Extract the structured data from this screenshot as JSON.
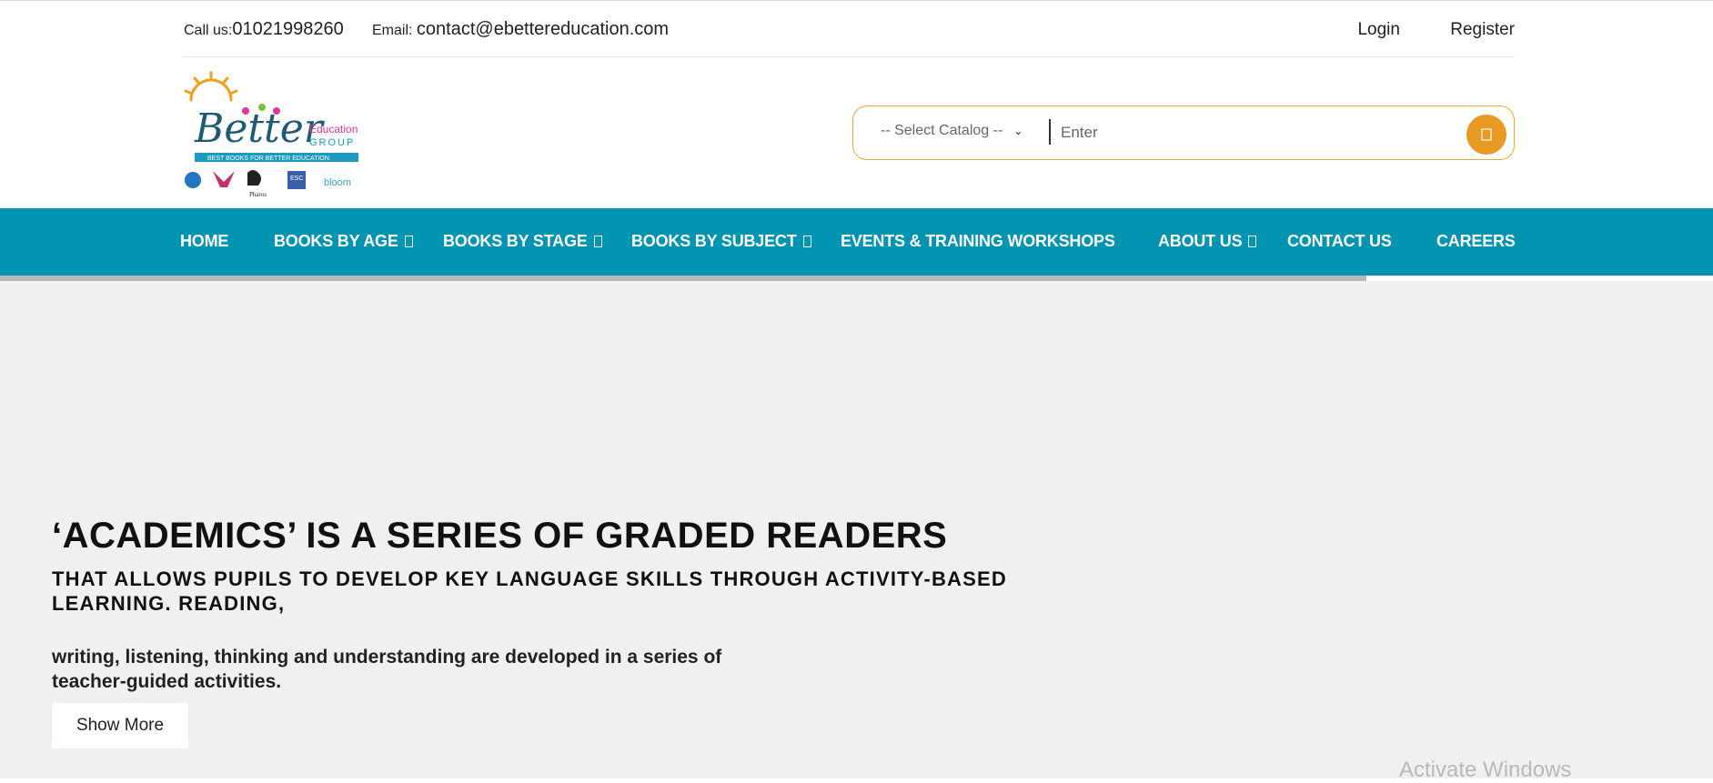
{
  "topbar": {
    "call_label": "Call us:",
    "call_value": "01021998260",
    "email_label": "Email:",
    "email_value": "contact@ebettereducation.com",
    "login": "Login",
    "register": "Register"
  },
  "logo": {
    "wordmark": "Better",
    "education": "Education",
    "group": "GROUP",
    "tagline": "BEST BOOKS FOR BETTER EDUCATION",
    "imprint_esc": "ESC",
    "imprint_pharos": "Pharos",
    "imprint_bloom": "bloom"
  },
  "search": {
    "catalog_placeholder": "-- Select Catalog --",
    "input_placeholder": "Enter",
    "button_icon": "search-icon"
  },
  "nav": {
    "items": [
      {
        "label": "HOME",
        "dropdown": false
      },
      {
        "label": "BOOKS BY AGE",
        "dropdown": true
      },
      {
        "label": "BOOKS BY STAGE",
        "dropdown": true
      },
      {
        "label": "BOOKS BY SUBJECT",
        "dropdown": true
      },
      {
        "label": "EVENTS & TRAINING WORKSHOPS",
        "dropdown": false
      },
      {
        "label": "ABOUT US",
        "dropdown": true
      },
      {
        "label": "CONTACT US",
        "dropdown": false
      },
      {
        "label": "CAREERS",
        "dropdown": false
      }
    ]
  },
  "hero": {
    "title": "‘ACADEMICS’ IS A SERIES OF GRADED READERS",
    "subtitle": "THAT ALLOWS PUPILS TO DEVELOP KEY LANGUAGE SKILLS THROUGH ACTIVITY-BASED LEARNING. READING,",
    "body": "writing, listening, thinking and understanding are developed in a series of teacher-guided activities.",
    "button": "Show More"
  },
  "watermark": "Activate Windows",
  "colors": {
    "nav_bg": "#0094b3",
    "accent": "#e89a22",
    "hero_bg": "#f0f0f0"
  }
}
